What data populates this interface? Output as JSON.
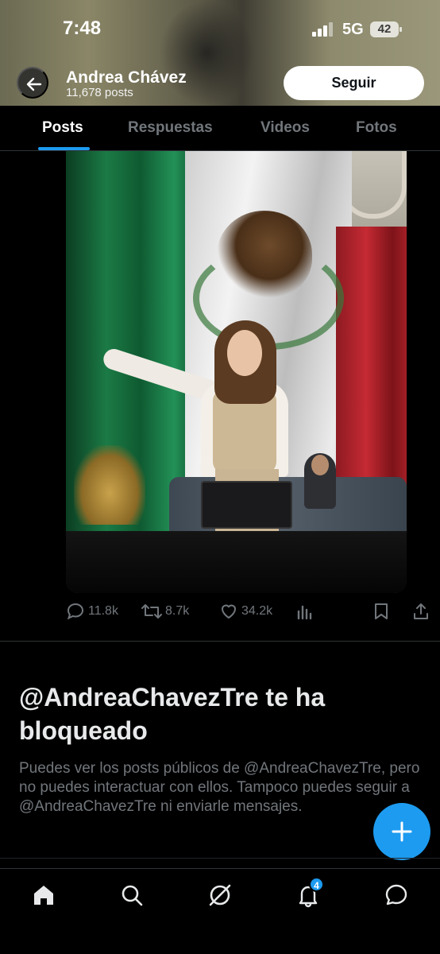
{
  "status_bar": {
    "time": "7:48",
    "network": "5G",
    "battery": "42"
  },
  "profile": {
    "name": "Andrea Chávez",
    "post_count": "11,678 posts",
    "follow_label": "Seguir"
  },
  "tabs": [
    {
      "label": "Posts",
      "active": true
    },
    {
      "label": "Respuestas",
      "active": false
    },
    {
      "label": "Videos",
      "active": false
    },
    {
      "label": "Fotos",
      "active": false
    }
  ],
  "post": {
    "replies": "11.8k",
    "reposts": "8.7k",
    "likes": "34.2k"
  },
  "blocked": {
    "title": "@AndreaChavezTre te ha bloqueado",
    "text": "Puedes ver los posts públicos de @AndreaChavezTre, pero no puedes interactuar con ellos. Tampoco puedes seguir a @AndreaChavezTre ni enviarle mensajes."
  },
  "bottom_nav": {
    "items": [
      "home-icon",
      "search-icon",
      "grok-icon",
      "notifications-icon",
      "messages-icon"
    ],
    "notification_badge": "4"
  },
  "colors": {
    "accent": "#1d9bf0",
    "background": "#000000",
    "muted_text": "#71767b"
  }
}
